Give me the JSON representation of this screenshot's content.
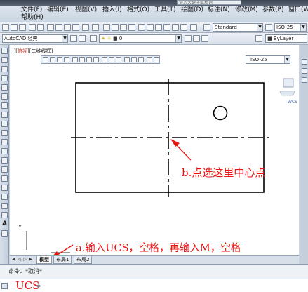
{
  "title_bar": {
    "search_placeholder": "键入关键字或短语"
  },
  "menu": {
    "row1": [
      "文件(F)",
      "编辑(E)",
      "视图(V)",
      "插入(I)",
      "格式(O)",
      "工具(T)",
      "绘图(D)",
      "标注(N)",
      "修改(M)",
      "参数(P)",
      "窗口(W)"
    ],
    "row2": [
      "帮助(H)"
    ]
  },
  "toolbar1": {
    "text_style": "Standard",
    "dim_style": "ISO-25"
  },
  "toolbar2": {
    "workspace": "AutoCAD 经典",
    "layer": "0",
    "linetype": "ByLayer"
  },
  "viewport": {
    "label_prefix": "-][",
    "label_tag": "俯视",
    "label_suffix": "][二维线框]",
    "dim_style_combo": "ISO-25",
    "wcs": "WCS"
  },
  "annotations": {
    "b": "b.点选这里中心点",
    "a": "a.输入UCS，空格，再输入M，空格"
  },
  "tabs": {
    "model": "模型",
    "layout1": "布局1",
    "layout2": "布局2"
  },
  "command": {
    "history": "命令：*取消*",
    "input": "UCS",
    "input_tail": "✱"
  },
  "colors": {
    "annotation_red": "#e81414",
    "drawing_background": "#ffffff"
  }
}
